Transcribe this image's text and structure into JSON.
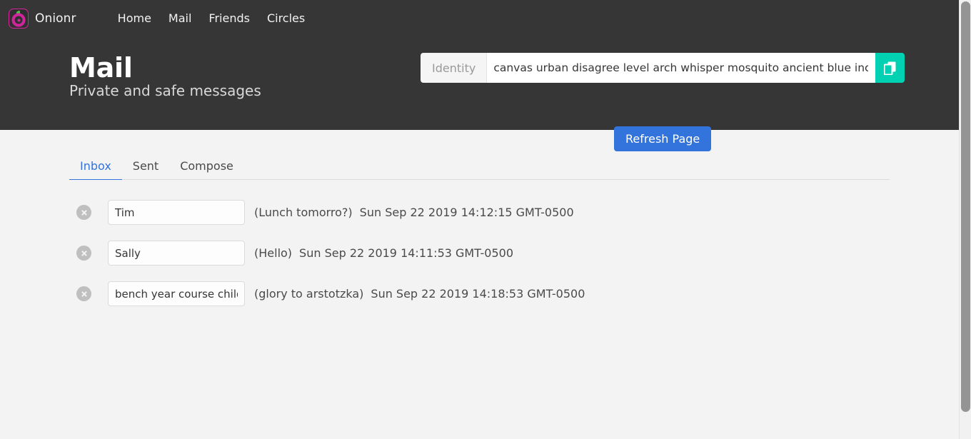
{
  "navbar": {
    "brand_name": "Onionr",
    "logo_icon": "onion-logo-icon",
    "links": [
      {
        "label": "Home"
      },
      {
        "label": "Mail"
      },
      {
        "label": "Friends"
      },
      {
        "label": "Circles"
      }
    ]
  },
  "hero": {
    "title": "Mail",
    "subtitle": "Private and safe messages",
    "identity_label": "Identity",
    "identity_value": "canvas urban disagree level arch whisper mosquito ancient blue include ele",
    "identity_placeholder": "",
    "copy_button_icon": "copy-icon",
    "refresh_button": "Refresh Page"
  },
  "tabs": [
    {
      "label": "Inbox",
      "active": true
    },
    {
      "label": "Sent",
      "active": false
    },
    {
      "label": "Compose",
      "active": false
    }
  ],
  "messages": [
    {
      "delete_icon": "close-icon",
      "sender": "Tim",
      "subject": "(Lunch tomorro?)",
      "date": "Sun Sep 22 2019 14:12:15 GMT-0500"
    },
    {
      "delete_icon": "close-icon",
      "sender": "Sally",
      "subject": "(Hello)",
      "date": "Sun Sep 22 2019 14:11:53 GMT-0500"
    },
    {
      "delete_icon": "close-icon",
      "sender": "bench year course child current",
      "subject": "(glory to arstotzka)",
      "date": "Sun Sep 22 2019 14:18:53 GMT-0500"
    }
  ],
  "colors": {
    "header_background": "#363636",
    "page_background": "#f3f3f3",
    "accent_teal": "#00d1b2",
    "accent_blue": "#3273dc",
    "logo_pink": "#d6249f",
    "logo_green": "#43c93b"
  }
}
